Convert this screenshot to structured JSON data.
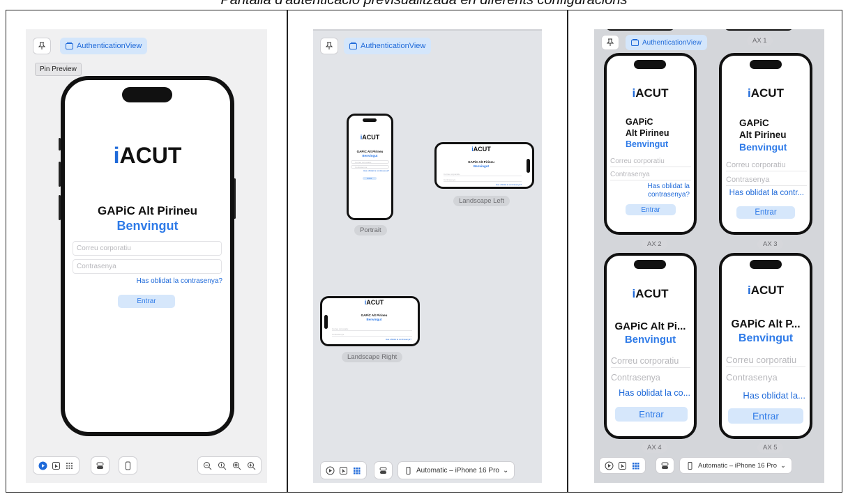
{
  "caption": "Pantalla d'autenticació previsualitzada en diferents configuracions",
  "panels": {
    "single": {
      "view_chip": "AuthenticationView",
      "tooltip": "Pin Preview"
    },
    "variants": {
      "view_chip": "AuthenticationView",
      "labels": [
        "Portrait",
        "Landscape Left",
        "Landscape Right"
      ],
      "device": "Automatic – iPhone 16 Pro"
    },
    "dynamic_type": {
      "view_chip": "AuthenticationView",
      "labels": [
        "AX 1",
        "AX 2",
        "AX 3",
        "AX 4",
        "AX 5"
      ],
      "device": "Automatic – iPhone 16 Pro"
    }
  },
  "app": {
    "logo_i": "i",
    "logo_rest": "ACUT",
    "org": "GAPiC Alt Pirineu",
    "org_line1": "GAPiC",
    "org_line2": "Alt Pirineu",
    "org_trunc_ax4": "GAPiC Alt Pi...",
    "org_trunc_ax5": "GAPiC Alt P...",
    "welcome": "Benvingut",
    "email_placeholder": "Correu corporatiu",
    "password_placeholder": "Contrasenya",
    "forgot": "Has oblidat la contrasenya?",
    "forgot_ax2_line1": "Has oblidat la",
    "forgot_ax2_line2": "contrasenya?",
    "forgot_ax3": "Has oblidat la contr...",
    "forgot_ax4": "Has oblidat la co...",
    "forgot_ax5": "Has oblidat la...",
    "enter": "Entrar"
  },
  "colors": {
    "accent": "#1f6ad9",
    "welcome": "#2f7be8",
    "button_bg": "#d6e7fb"
  }
}
